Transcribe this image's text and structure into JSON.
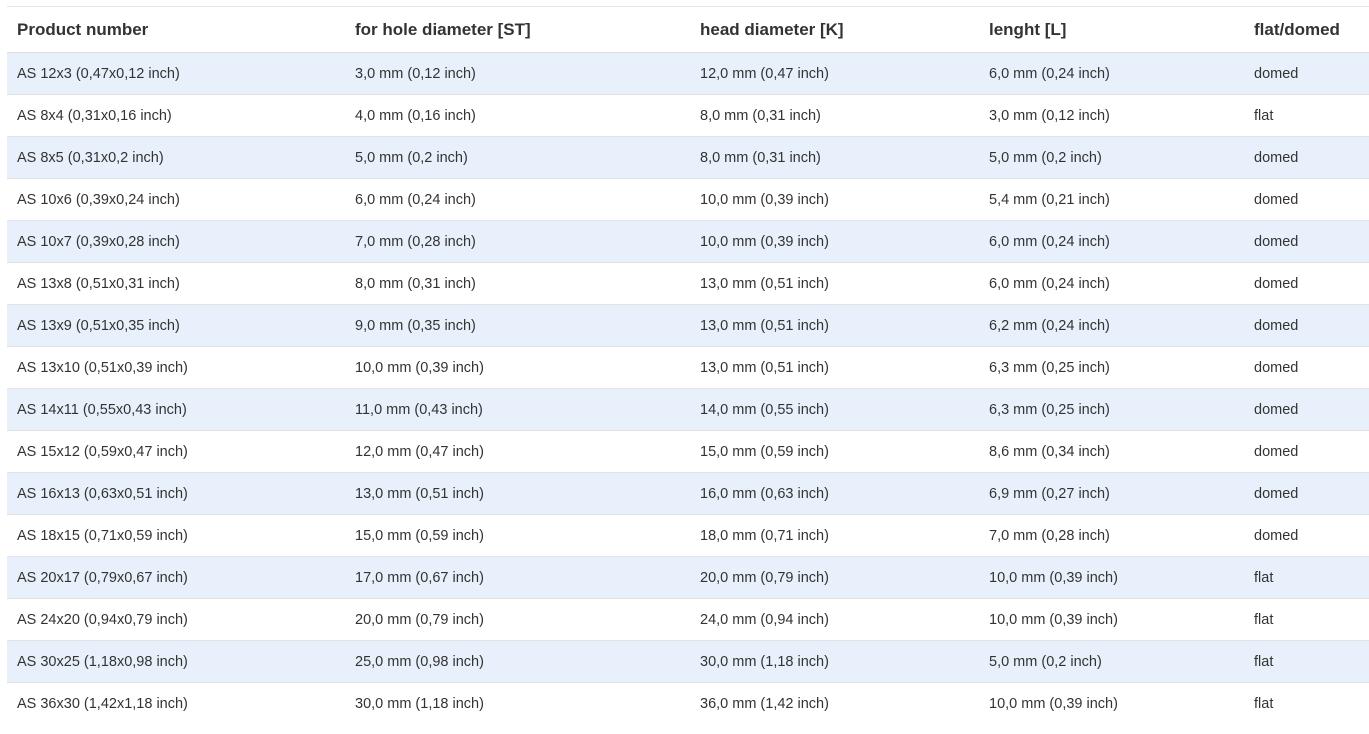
{
  "table": {
    "headers": [
      "Product number",
      "for hole diameter [ST]",
      "head diameter [K]",
      "lenght [L]",
      "flat/domed"
    ],
    "rows": [
      [
        "AS 12x3 (0,47x0,12 inch)",
        "3,0 mm (0,12 inch)",
        "12,0 mm (0,47 inch)",
        "6,0 mm (0,24 inch)",
        "domed"
      ],
      [
        "AS 8x4 (0,31x0,16 inch)",
        "4,0 mm (0,16 inch)",
        "8,0 mm (0,31 inch)",
        "3,0 mm (0,12 inch)",
        "flat"
      ],
      [
        "AS 8x5 (0,31x0,2 inch)",
        "5,0 mm (0,2 inch)",
        "8,0 mm (0,31 inch)",
        "5,0 mm (0,2 inch)",
        "domed"
      ],
      [
        "AS 10x6 (0,39x0,24 inch)",
        "6,0 mm (0,24 inch)",
        "10,0 mm (0,39 inch)",
        "5,4 mm (0,21 inch)",
        "domed"
      ],
      [
        "AS 10x7 (0,39x0,28 inch)",
        "7,0 mm (0,28 inch)",
        "10,0 mm (0,39 inch)",
        "6,0 mm (0,24 inch)",
        "domed"
      ],
      [
        "AS 13x8 (0,51x0,31 inch)",
        "8,0 mm (0,31 inch)",
        "13,0 mm (0,51 inch)",
        "6,0 mm (0,24 inch)",
        "domed"
      ],
      [
        "AS 13x9 (0,51x0,35 inch)",
        "9,0 mm (0,35 inch)",
        "13,0 mm (0,51 inch)",
        "6,2 mm (0,24 inch)",
        "domed"
      ],
      [
        "AS 13x10 (0,51x0,39 inch)",
        "10,0 mm (0,39 inch)",
        "13,0 mm (0,51 inch)",
        "6,3 mm (0,25 inch)",
        "domed"
      ],
      [
        "AS 14x11 (0,55x0,43 inch)",
        "11,0 mm (0,43 inch)",
        "14,0 mm (0,55 inch)",
        "6,3 mm (0,25 inch)",
        "domed"
      ],
      [
        "AS 15x12 (0,59x0,47 inch)",
        "12,0 mm (0,47 inch)",
        "15,0 mm (0,59 inch)",
        "8,6 mm (0,34 inch)",
        "domed"
      ],
      [
        "AS 16x13 (0,63x0,51 inch)",
        "13,0 mm (0,51 inch)",
        "16,0 mm (0,63 inch)",
        "6,9 mm (0,27 inch)",
        "domed"
      ],
      [
        "AS 18x15 (0,71x0,59 inch)",
        "15,0 mm (0,59 inch)",
        "18,0 mm (0,71 inch)",
        "7,0 mm (0,28 inch)",
        "domed"
      ],
      [
        "AS 20x17 (0,79x0,67 inch)",
        "17,0 mm (0,67 inch)",
        "20,0 mm (0,79 inch)",
        "10,0 mm (0,39 inch)",
        "flat"
      ],
      [
        "AS 24x20 (0,94x0,79 inch)",
        "20,0 mm (0,79 inch)",
        "24,0 mm (0,94 inch)",
        "10,0 mm (0,39 inch)",
        "flat"
      ],
      [
        "AS 30x25 (1,18x0,98 inch)",
        "25,0 mm (0,98 inch)",
        "30,0 mm (1,18 inch)",
        "5,0 mm (0,2 inch)",
        "flat"
      ],
      [
        "AS 36x30 (1,42x1,18 inch)",
        "30,0 mm (1,18 inch)",
        "36,0 mm (1,42 inch)",
        "10,0 mm (0,39 inch)",
        "flat"
      ]
    ]
  },
  "colors": {
    "stripe": "#e8f1fb",
    "text": "#333333",
    "border": "#e2e2e2"
  }
}
